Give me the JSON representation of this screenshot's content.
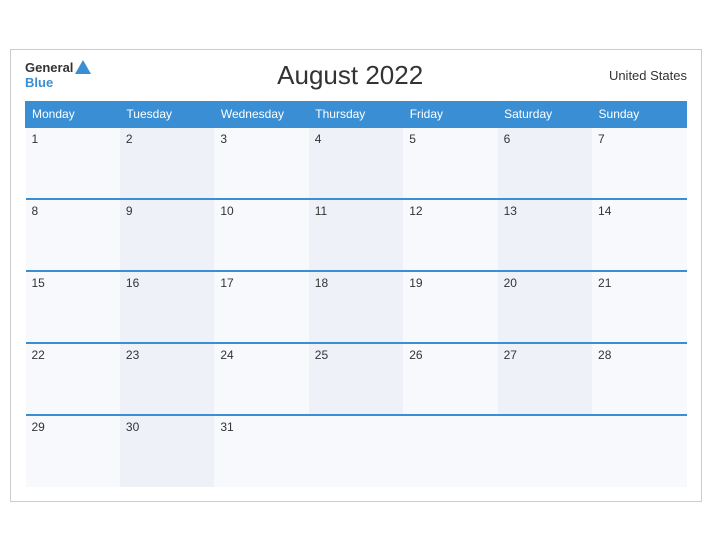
{
  "header": {
    "logo_general": "General",
    "logo_blue": "Blue",
    "title": "August 2022",
    "country": "United States"
  },
  "weekdays": [
    "Monday",
    "Tuesday",
    "Wednesday",
    "Thursday",
    "Friday",
    "Saturday",
    "Sunday"
  ],
  "weeks": [
    [
      "1",
      "2",
      "3",
      "4",
      "5",
      "6",
      "7"
    ],
    [
      "8",
      "9",
      "10",
      "11",
      "12",
      "13",
      "14"
    ],
    [
      "15",
      "16",
      "17",
      "18",
      "19",
      "20",
      "21"
    ],
    [
      "22",
      "23",
      "24",
      "25",
      "26",
      "27",
      "28"
    ],
    [
      "29",
      "30",
      "31",
      "",
      "",
      "",
      ""
    ]
  ]
}
